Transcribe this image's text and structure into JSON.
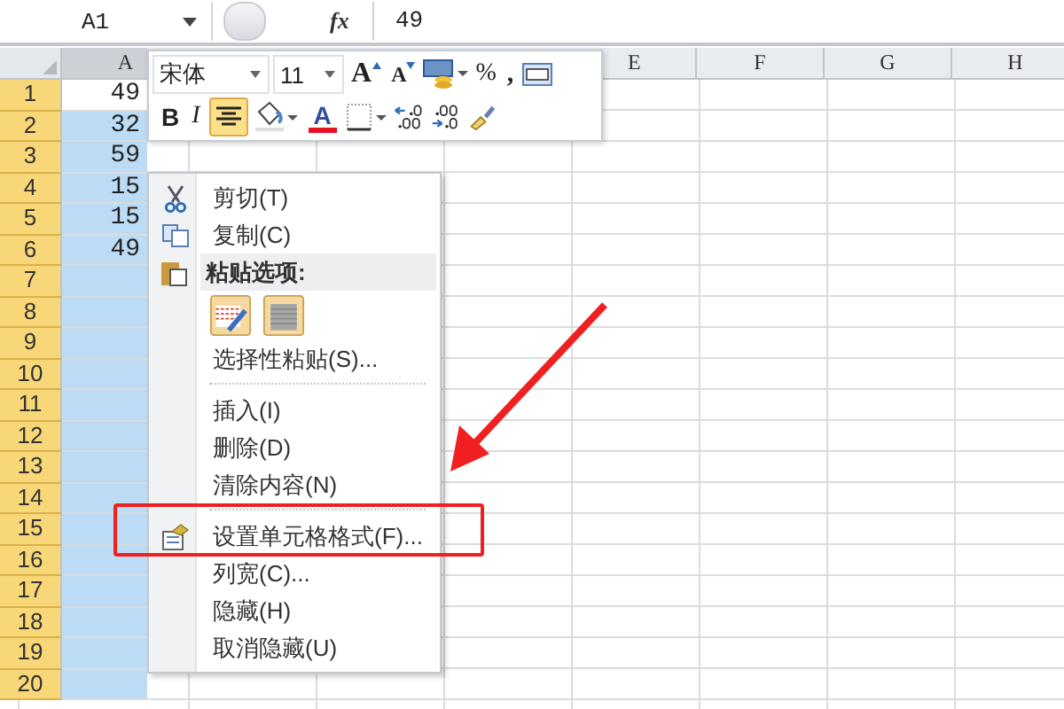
{
  "formula_bar": {
    "name_box": "A1",
    "fx": "fx",
    "value": "49"
  },
  "columns": [
    {
      "label": "A",
      "selected": true
    },
    {
      "label": "E",
      "selected": false
    },
    {
      "label": "F",
      "selected": false
    },
    {
      "label": "G",
      "selected": false
    },
    {
      "label": "H",
      "selected": false
    }
  ],
  "rows": [
    {
      "number": "1",
      "selected": true,
      "value": "49",
      "active": true
    },
    {
      "number": "2",
      "selected": true,
      "value": "32",
      "active": false
    },
    {
      "number": "3",
      "selected": true,
      "value": "59",
      "active": false
    },
    {
      "number": "4",
      "selected": true,
      "value": "15",
      "active": false
    },
    {
      "number": "5",
      "selected": true,
      "value": "15",
      "active": false
    },
    {
      "number": "6",
      "selected": true,
      "value": "49",
      "active": false
    },
    {
      "number": "7",
      "selected": true,
      "active": false
    },
    {
      "number": "8",
      "selected": true,
      "active": false
    },
    {
      "number": "9",
      "selected": true,
      "active": false
    },
    {
      "number": "10",
      "selected": true,
      "active": false
    },
    {
      "number": "11",
      "selected": true,
      "active": false
    },
    {
      "number": "12",
      "selected": true,
      "active": false
    },
    {
      "number": "13",
      "selected": true,
      "active": false
    },
    {
      "number": "14",
      "selected": true,
      "active": false
    },
    {
      "number": "15",
      "selected": true,
      "active": false
    },
    {
      "number": "16",
      "selected": true,
      "active": false
    },
    {
      "number": "17",
      "selected": true,
      "active": false
    },
    {
      "number": "18",
      "selected": true,
      "active": false
    },
    {
      "number": "19",
      "selected": true,
      "active": false
    },
    {
      "number": "20",
      "selected": true,
      "active": false
    }
  ],
  "mini_toolbar": {
    "font": "宋体",
    "size": "11",
    "row_1": [
      {
        "kind": "grow",
        "label": "A"
      },
      {
        "kind": "shrink",
        "label": "A"
      },
      {
        "kind": "accounting"
      },
      {
        "kind": "percent",
        "label": "%"
      },
      {
        "kind": "comma",
        "label": ","
      },
      {
        "kind": "merge"
      }
    ],
    "row_2": [
      {
        "kind": "bold",
        "label": "B",
        "selected": false
      },
      {
        "kind": "italic",
        "label": "I",
        "selected": false
      },
      {
        "kind": "center",
        "selected": true
      },
      {
        "kind": "fill"
      },
      {
        "kind": "fontcolor",
        "label": "A",
        "color": "#e81123"
      },
      {
        "kind": "border"
      },
      {
        "kind": "increase"
      },
      {
        "kind": "decrease"
      },
      {
        "kind": "painter"
      }
    ]
  },
  "context_menu": [
    {
      "kind": "cut",
      "label": "剪切(T)"
    },
    {
      "kind": "copy",
      "label": "复制(C)"
    },
    {
      "kind": "paste",
      "label": "粘贴选项:"
    },
    {
      "kind": "options"
    },
    {
      "kind": "plain",
      "label": "选择性粘贴(S)..."
    },
    {
      "kind": "separator"
    },
    {
      "kind": "plain",
      "label": "插入(I)"
    },
    {
      "kind": "plain",
      "label": "删除(D)"
    },
    {
      "kind": "plain",
      "label": "清除内容(N)"
    },
    {
      "kind": "separator"
    },
    {
      "kind": "format",
      "label": "设置单元格格式(F)..."
    },
    {
      "kind": "plain",
      "label": "列宽(C)..."
    },
    {
      "kind": "plain",
      "label": "隐藏(H)"
    },
    {
      "kind": "plain",
      "label": "取消隐藏(U)"
    }
  ]
}
